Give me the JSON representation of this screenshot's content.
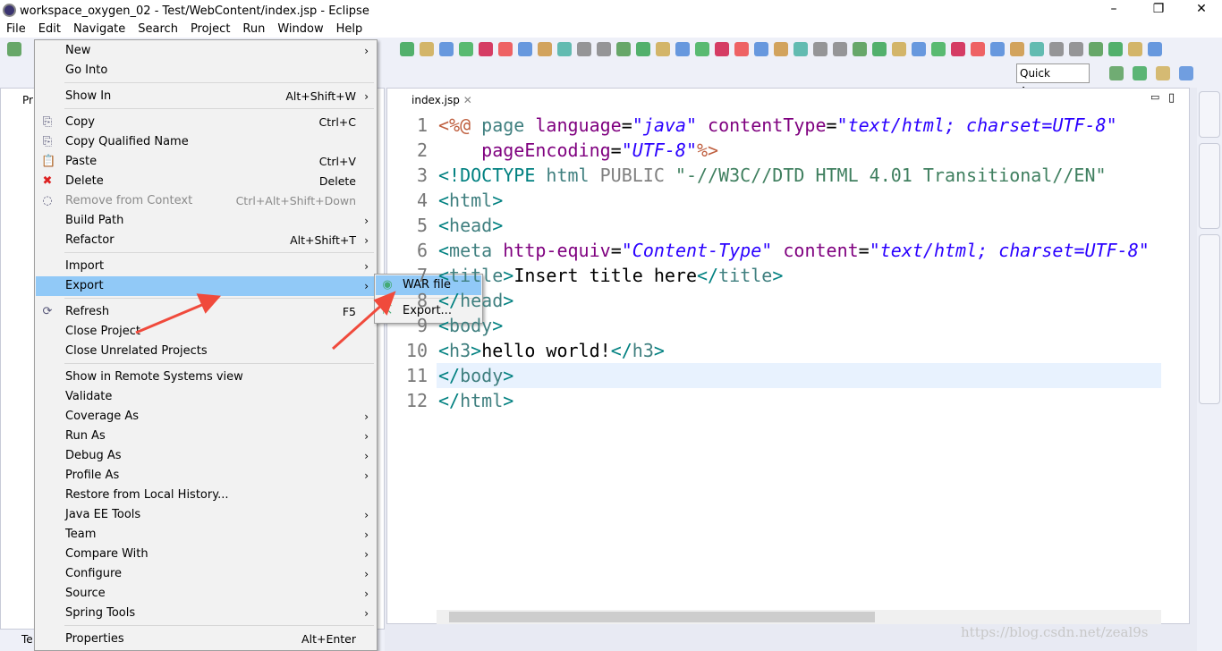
{
  "window": {
    "title": "workspace_oxygen_02 - Test/WebContent/index.jsp - Eclipse"
  },
  "menubar": [
    "File",
    "Edit",
    "Navigate",
    "Search",
    "Project",
    "Run",
    "Window",
    "Help"
  ],
  "toolbar": {
    "quick_access": "Quick Access"
  },
  "left_view": {
    "tab_label": "Pr",
    "bottom_tab": "Te"
  },
  "editor": {
    "tab_label": "index.jsp",
    "line_numbers": [
      "1",
      "2",
      "3",
      "4",
      "5",
      "6",
      "7",
      "8",
      "9",
      "10",
      "11",
      "12"
    ],
    "current_line": 11,
    "lines": [
      [
        [
          "<%@",
          "jsp"
        ],
        [
          " page ",
          "tag"
        ],
        [
          "language",
          "attr"
        ],
        [
          "=",
          ""
        ],
        [
          "\"java\"",
          "val"
        ],
        [
          " ",
          ""
        ],
        [
          "contentType",
          "attr"
        ],
        [
          "=",
          ""
        ],
        [
          "\"text/html; charset=UTF-8\"",
          "val"
        ]
      ],
      [
        [
          "    ",
          ""
        ],
        [
          "pageEncoding",
          "attr"
        ],
        [
          "=",
          ""
        ],
        [
          "\"UTF-8\"",
          "val"
        ],
        [
          "%>",
          "jsp"
        ]
      ],
      [
        [
          "<!DOCTYPE",
          "br"
        ],
        [
          " html ",
          "tag"
        ],
        [
          "PUBLIC",
          "doc"
        ],
        [
          " \"-//W3C//DTD HTML 4.01 Transitional//EN\"",
          "str"
        ]
      ],
      [
        [
          "<",
          "br"
        ],
        [
          "html",
          "tag"
        ],
        [
          ">",
          "br"
        ]
      ],
      [
        [
          "<",
          "br"
        ],
        [
          "head",
          "tag"
        ],
        [
          ">",
          "br"
        ]
      ],
      [
        [
          "<",
          "br"
        ],
        [
          "meta",
          "tag"
        ],
        [
          " ",
          ""
        ],
        [
          "http-equiv",
          "attr"
        ],
        [
          "=",
          ""
        ],
        [
          "\"Content-Type\"",
          "val"
        ],
        [
          " ",
          ""
        ],
        [
          "content",
          "attr"
        ],
        [
          "=",
          ""
        ],
        [
          "\"text/html; charset=UTF-8\"",
          "val"
        ]
      ],
      [
        [
          "<",
          "br"
        ],
        [
          "title",
          "tag"
        ],
        [
          ">",
          "br"
        ],
        [
          "Insert title here",
          ""
        ],
        [
          "</",
          "br"
        ],
        [
          "title",
          "tag"
        ],
        [
          ">",
          "br"
        ]
      ],
      [
        [
          "</",
          "br"
        ],
        [
          "head",
          "tag"
        ],
        [
          ">",
          "br"
        ]
      ],
      [
        [
          "<",
          "br"
        ],
        [
          "body",
          "tag"
        ],
        [
          ">",
          "br"
        ]
      ],
      [
        [
          "<",
          "br"
        ],
        [
          "h3",
          "tag"
        ],
        [
          ">",
          "br"
        ],
        [
          "hello world!",
          ""
        ],
        [
          "</",
          "br"
        ],
        [
          "h3",
          "tag"
        ],
        [
          ">",
          "br"
        ]
      ],
      [
        [
          "</",
          "br"
        ],
        [
          "body",
          "tag"
        ],
        [
          ">",
          "br"
        ]
      ],
      [
        [
          "</",
          "br"
        ],
        [
          "html",
          "tag"
        ],
        [
          ">",
          "br"
        ]
      ]
    ]
  },
  "context_menu": {
    "items": [
      {
        "label": "New",
        "submenu": true
      },
      {
        "label": "Go Into"
      },
      {
        "sep": true
      },
      {
        "label": "Show In",
        "shortcut": "Alt+Shift+W",
        "submenu": true
      },
      {
        "sep": true
      },
      {
        "label": "Copy",
        "shortcut": "Ctrl+C",
        "icon": "copy-icon"
      },
      {
        "label": "Copy Qualified Name",
        "icon": "copy-qualified-icon"
      },
      {
        "label": "Paste",
        "shortcut": "Ctrl+V",
        "icon": "paste-icon"
      },
      {
        "label": "Delete",
        "shortcut": "Delete",
        "icon": "delete-icon"
      },
      {
        "label": "Remove from Context",
        "shortcut": "Ctrl+Alt+Shift+Down",
        "disabled": true,
        "icon": "remove-context-icon"
      },
      {
        "label": "Build Path",
        "submenu": true
      },
      {
        "label": "Refactor",
        "shortcut": "Alt+Shift+T",
        "submenu": true
      },
      {
        "sep": true
      },
      {
        "label": "Import",
        "submenu": true
      },
      {
        "label": "Export",
        "submenu": true,
        "highlighted": true
      },
      {
        "sep": true
      },
      {
        "label": "Refresh",
        "shortcut": "F5",
        "icon": "refresh-icon"
      },
      {
        "label": "Close Project"
      },
      {
        "label": "Close Unrelated Projects"
      },
      {
        "sep": true
      },
      {
        "label": "Show in Remote Systems view"
      },
      {
        "label": "Validate"
      },
      {
        "label": "Coverage As",
        "submenu": true
      },
      {
        "label": "Run As",
        "submenu": true
      },
      {
        "label": "Debug As",
        "submenu": true
      },
      {
        "label": "Profile As",
        "submenu": true
      },
      {
        "label": "Restore from Local History..."
      },
      {
        "label": "Java EE Tools",
        "submenu": true
      },
      {
        "label": "Team",
        "submenu": true
      },
      {
        "label": "Compare With",
        "submenu": true
      },
      {
        "label": "Configure",
        "submenu": true
      },
      {
        "label": "Source",
        "submenu": true
      },
      {
        "label": "Spring Tools",
        "submenu": true
      },
      {
        "sep": true
      },
      {
        "label": "Properties",
        "shortcut": "Alt+Enter"
      }
    ]
  },
  "export_submenu": {
    "items": [
      {
        "label": "WAR file",
        "highlighted": true
      },
      {
        "label": "Export..."
      }
    ]
  },
  "watermark": "https://blog.csdn.net/zeal9s",
  "colors": {
    "highlight": "#91c9f7",
    "arrow": "#f04a3c",
    "tag": "#3f7f7f",
    "attr": "#7f007f",
    "value": "#2a00ff",
    "jsp": "#bf5f3f"
  }
}
